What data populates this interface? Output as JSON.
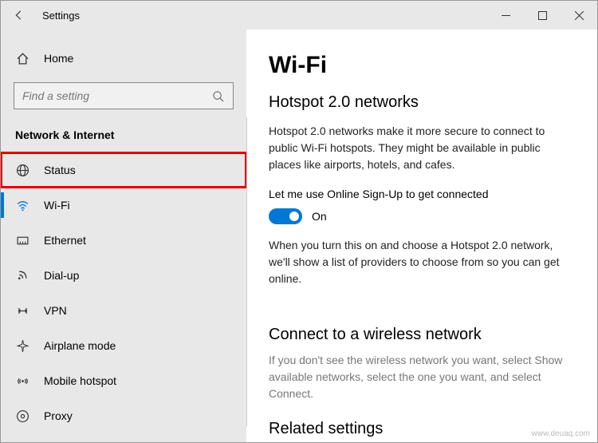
{
  "titlebar": {
    "title": "Settings"
  },
  "sidebar": {
    "home_label": "Home",
    "search_placeholder": "Find a setting",
    "category": "Network & Internet",
    "items": [
      {
        "label": "Status"
      },
      {
        "label": "Wi-Fi"
      },
      {
        "label": "Ethernet"
      },
      {
        "label": "Dial-up"
      },
      {
        "label": "VPN"
      },
      {
        "label": "Airplane mode"
      },
      {
        "label": "Mobile hotspot"
      },
      {
        "label": "Proxy"
      }
    ]
  },
  "content": {
    "h1": "Wi-Fi",
    "section1": {
      "heading": "Hotspot 2.0 networks",
      "desc": "Hotspot 2.0 networks make it more secure to connect to public Wi-Fi hotspots. They might be available in public places like airports, hotels, and cafes.",
      "toggle_label": "Let me use Online Sign-Up to get connected",
      "toggle_state": "On",
      "desc2": "When you turn this on and choose a Hotspot 2.0 network, we'll show a list of providers to choose from so you can get online."
    },
    "section2": {
      "heading": "Connect to a wireless network",
      "desc": "If you don't see the wireless network you want, select Show available networks, select the one you want, and select Connect."
    },
    "section3": {
      "heading": "Related settings"
    }
  },
  "watermark": "www.deuaq.com"
}
